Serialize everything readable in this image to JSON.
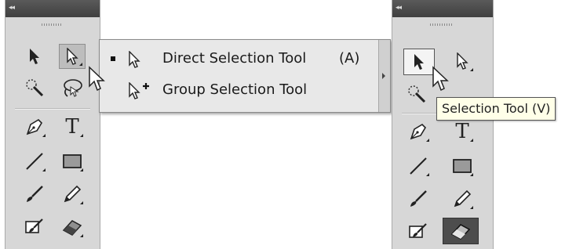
{
  "left_panel": {
    "collapse_glyph": "◂◂",
    "tools": [
      {
        "name": "selection-tool",
        "icon": "arrow-black-icon"
      },
      {
        "name": "direct-selection-tool",
        "icon": "arrow-white-icon",
        "state": "highlighted"
      },
      {
        "name": "magic-wand-tool",
        "icon": "magic-wand-icon"
      },
      {
        "name": "lasso-tool",
        "icon": "lasso-icon"
      },
      {
        "name": "pen-tool",
        "icon": "pen-nib-icon"
      },
      {
        "name": "type-tool",
        "icon": "type-T-icon",
        "glyph": "T"
      },
      {
        "name": "line-segment-tool",
        "icon": "line-icon"
      },
      {
        "name": "rectangle-tool",
        "icon": "rectangle-icon"
      },
      {
        "name": "paintbrush-tool",
        "icon": "paintbrush-icon"
      },
      {
        "name": "pencil-tool",
        "icon": "pencil-icon"
      },
      {
        "name": "blob-brush-tool",
        "icon": "blob-brush-icon"
      },
      {
        "name": "eraser-tool",
        "icon": "eraser-icon"
      }
    ]
  },
  "flyout": {
    "items": [
      {
        "label": "Direct Selection Tool",
        "shortcut": "(A)",
        "icon": "arrow-white-icon",
        "current": true
      },
      {
        "label": "Group Selection Tool",
        "shortcut": "",
        "icon": "arrow-plus-icon",
        "current": false
      }
    ]
  },
  "right_panel": {
    "collapse_glyph": "◂◂",
    "tooltip": "Selection Tool (V)",
    "type_glyph": "T"
  },
  "colors": {
    "panel_bg": "#d7d7d7",
    "header_bg": "#4a4a4a",
    "tooltip_bg": "#ffffe8",
    "active_tool_bg": "#4d4d4d"
  }
}
